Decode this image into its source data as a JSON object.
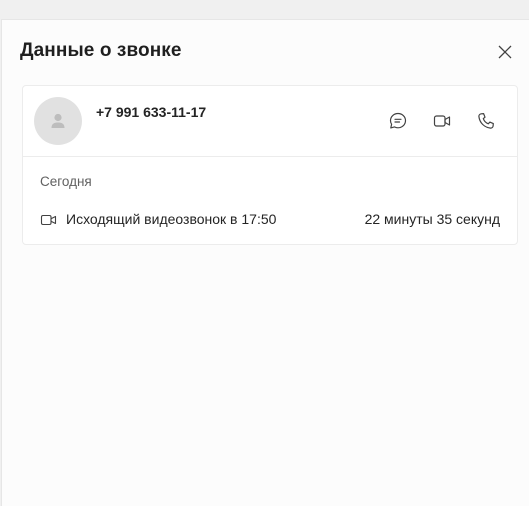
{
  "panel": {
    "title": "Данные о звонке",
    "close_icon": "close-icon"
  },
  "contact": {
    "phone": "+7 991 633-11-17",
    "avatar_icon": "person-icon",
    "actions": [
      {
        "name": "chat",
        "icon": "chat-icon"
      },
      {
        "name": "video",
        "icon": "video-camera-icon"
      },
      {
        "name": "call",
        "icon": "phone-icon"
      }
    ]
  },
  "history": {
    "day": "Сегодня",
    "entries": [
      {
        "icon": "video-camera-icon",
        "description": "Исходящий видеозвонок в 17:50",
        "duration": "22 минуты 35 секунд"
      }
    ]
  },
  "colors": {
    "background": "#f0f0f0",
    "panel": "#fcfcfc",
    "card": "#ffffff",
    "avatar": "#e1e1e1",
    "text": "#242424",
    "muted": "#616161"
  }
}
